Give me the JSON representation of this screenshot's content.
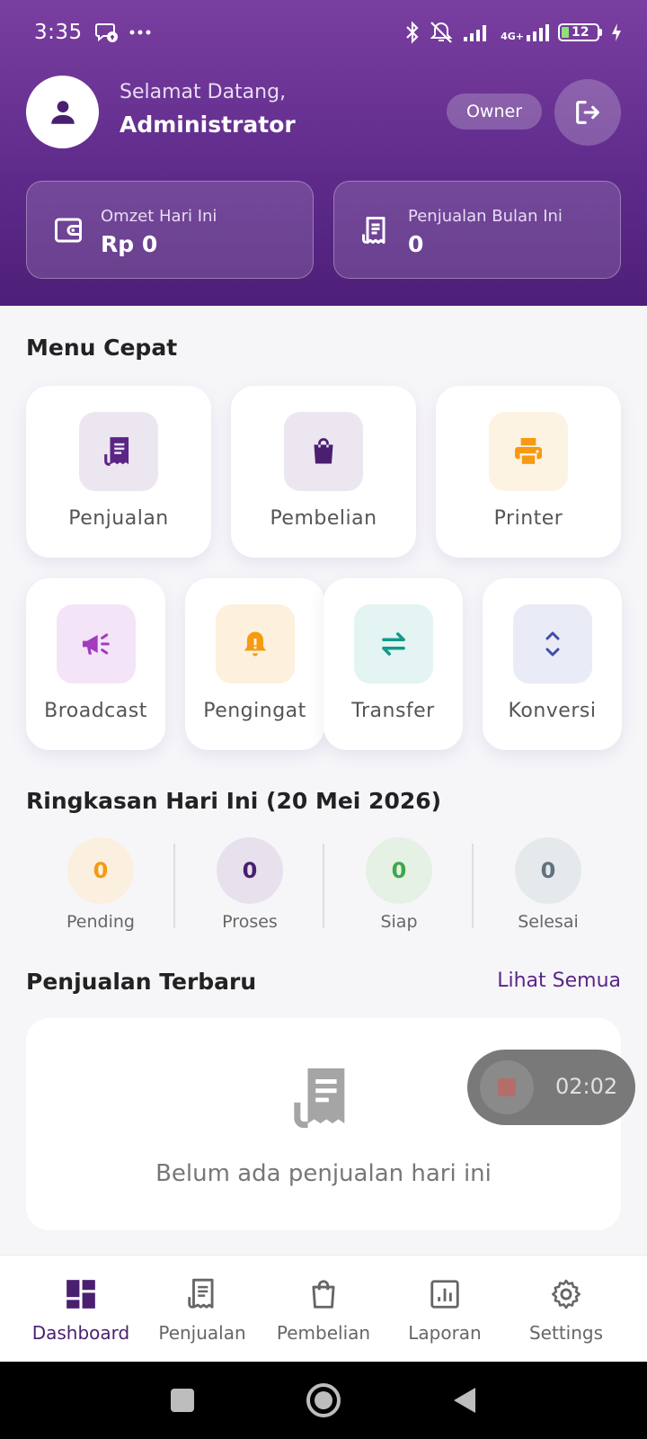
{
  "status_bar": {
    "time": "3:35",
    "network": "4G+",
    "battery": "12"
  },
  "header": {
    "welcome": "Selamat Datang,",
    "username": "Administrator",
    "role": "Owner"
  },
  "stats": [
    {
      "label": "Omzet Hari Ini",
      "value": "Rp 0",
      "icon": "wallet-icon"
    },
    {
      "label": "Penjualan Bulan Ini",
      "value": "0",
      "icon": "receipt-icon"
    }
  ],
  "quick_menu": {
    "title": "Menu Cepat",
    "items": [
      {
        "label": "Penjualan",
        "icon": "receipt-icon",
        "color": "#5b2585",
        "bg": "#ece6f1"
      },
      {
        "label": "Pembelian",
        "icon": "shopping-bag-icon",
        "color": "#4a1f70",
        "bg": "#ece6f1"
      },
      {
        "label": "Printer",
        "icon": "printer-icon",
        "color": "#f59a12",
        "bg": "#fdf3e3"
      },
      {
        "label": "Broadcast",
        "icon": "megaphone-icon",
        "color": "#a33ac0",
        "bg": "#f4e4f8"
      },
      {
        "label": "Pengingat",
        "icon": "bell-icon",
        "color": "#f59a12",
        "bg": "#fdf0dd"
      },
      {
        "label": "Transfer",
        "icon": "transfer-icon",
        "color": "#129a8a",
        "bg": "#e3f4f2"
      },
      {
        "label": "Konversi",
        "icon": "unfold-icon",
        "color": "#3f4ea8",
        "bg": "#e9ebf6"
      }
    ]
  },
  "summary": {
    "title": "Ringkasan Hari Ini (20 Mei 2026)",
    "items": [
      {
        "label": "Pending",
        "value": "0",
        "color": "#f59a12",
        "bg": "#fbefdf"
      },
      {
        "label": "Proses",
        "value": "0",
        "color": "#4a1f70",
        "bg": "#e7e1ee"
      },
      {
        "label": "Siap",
        "value": "0",
        "color": "#3fa64a",
        "bg": "#e4f1e4"
      },
      {
        "label": "Selesai",
        "value": "0",
        "color": "#5f7280",
        "bg": "#e6e9ec"
      }
    ]
  },
  "recent_sales": {
    "title": "Penjualan Terbaru",
    "see_all": "Lihat Semua",
    "empty_text": "Belum ada penjualan hari ini"
  },
  "recording": {
    "time": "02:02"
  },
  "bottom_nav": [
    {
      "label": "Dashboard",
      "icon": "dashboard-icon",
      "active": true
    },
    {
      "label": "Penjualan",
      "icon": "receipt-icon",
      "active": false
    },
    {
      "label": "Pembelian",
      "icon": "shopping-bag-icon",
      "active": false
    },
    {
      "label": "Laporan",
      "icon": "chart-icon",
      "active": false
    },
    {
      "label": "Settings",
      "icon": "gear-icon",
      "active": false
    }
  ],
  "colors": {
    "primary": "#5b2585",
    "header_gradient_top": "#7a3fa0",
    "header_gradient_bottom": "#4e1f78"
  }
}
